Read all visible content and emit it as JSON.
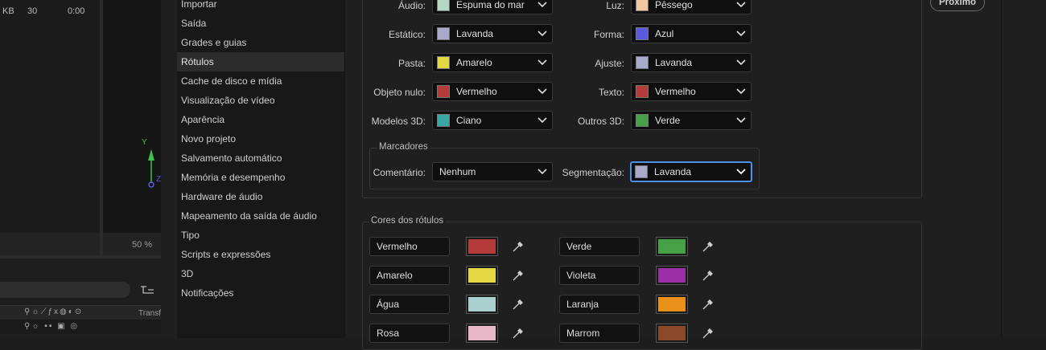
{
  "background_app": {
    "stats": {
      "kb": "KB",
      "count": "30",
      "time": "0:00"
    },
    "zoom": "50 %",
    "axis_y": "Y",
    "axis_z": "Z",
    "transform_label": "Transfo"
  },
  "nav": {
    "items": [
      {
        "label": "Importar"
      },
      {
        "label": "Saída"
      },
      {
        "label": "Grades e guias"
      },
      {
        "label": "Rótulos"
      },
      {
        "label": "Cache de disco e mídia"
      },
      {
        "label": "Visualização de vídeo"
      },
      {
        "label": "Aparência"
      },
      {
        "label": "Novo projeto"
      },
      {
        "label": "Salvamento automático"
      },
      {
        "label": "Memória e desempenho"
      },
      {
        "label": "Hardware de áudio"
      },
      {
        "label": "Mapeamento da saída de áudio"
      },
      {
        "label": "Tipo"
      },
      {
        "label": "Scripts e expressões"
      },
      {
        "label": "3D"
      },
      {
        "label": "Notificações"
      }
    ],
    "active": "Rótulos"
  },
  "defaults": {
    "left": [
      {
        "label": "Áudio:",
        "value": "Espuma do mar",
        "color": "#b5d8c4"
      },
      {
        "label": "Estático:",
        "value": "Lavanda",
        "color": "#a9a9cc"
      },
      {
        "label": "Pasta:",
        "value": "Amarelo",
        "color": "#e5d845"
      },
      {
        "label": "Objeto nulo:",
        "value": "Vermelho",
        "color": "#b53a3a"
      },
      {
        "label": "Modelos 3D:",
        "value": "Ciano",
        "color": "#3aa6a6"
      }
    ],
    "right": [
      {
        "label": "Luz:",
        "value": "Pêssego",
        "color": "#f0c8a0"
      },
      {
        "label": "Forma:",
        "value": "Azul",
        "color": "#5a5ae0"
      },
      {
        "label": "Ajuste:",
        "value": "Lavanda",
        "color": "#a9a9cc"
      },
      {
        "label": "Texto:",
        "value": "Vermelho",
        "color": "#b53a3a"
      },
      {
        "label": "Outros 3D:",
        "value": "Verde",
        "color": "#46a046"
      }
    ]
  },
  "markers": {
    "title": "Marcadores",
    "comment_label": "Comentário:",
    "comment_value": "Nenhum",
    "segmentation_label": "Segmentação:",
    "segmentation_value": "Lavanda",
    "segmentation_color": "#a9a9cc"
  },
  "label_colors": {
    "title": "Cores dos rótulos",
    "left": [
      {
        "name": "Vermelho",
        "color": "#b53a3a"
      },
      {
        "name": "Amarelo",
        "color": "#e5d845"
      },
      {
        "name": "Água",
        "color": "#a9cfcf"
      },
      {
        "name": "Rosa",
        "color": "#e8b8c8"
      }
    ],
    "right": [
      {
        "name": "Verde",
        "color": "#46a046"
      },
      {
        "name": "Violeta",
        "color": "#9a2fa8"
      },
      {
        "name": "Laranja",
        "color": "#e8901a"
      },
      {
        "name": "Marrom",
        "color": "#8a4a2a"
      }
    ]
  },
  "next_button": "Próximo",
  "icons": {
    "chevron": "chevron-down-icon",
    "eyedropper": "eyedropper-icon"
  }
}
